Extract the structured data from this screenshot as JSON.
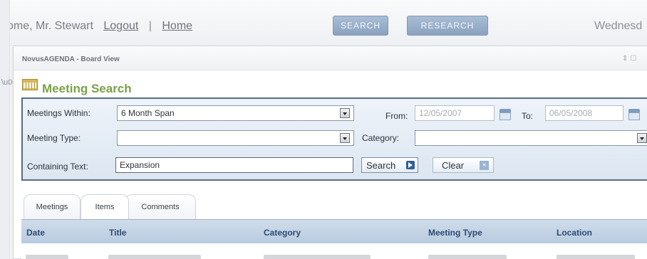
{
  "topbar": {
    "welcome_text": "come, Mr. Stewart",
    "logout_label": "Logout",
    "separator": "|",
    "home_label": "Home",
    "search_button": "SEARCH",
    "research_button": "RESEARCH",
    "date_text": "Wednesd"
  },
  "board": {
    "title": "NovusAGENDA - Board View",
    "window_controls": "⇕☐",
    "section_title": "Meeting Search"
  },
  "search_form": {
    "meetings_within_label": "Meetings Within:",
    "meetings_within_value": "6 Month Span",
    "from_label": "From:",
    "from_value": "12/05/2007",
    "to_label": "To:",
    "to_value": "06/05/2008",
    "meeting_type_label": "Meeting Type:",
    "meeting_type_value": "",
    "category_label": "Category:",
    "category_value": "",
    "containing_text_label": "Containing Text:",
    "containing_text_value": "Expansion",
    "search_button": "Search",
    "clear_button": "Clear",
    "clear_icon": "×"
  },
  "tabs": [
    {
      "label": "Meetings"
    },
    {
      "label": "Items",
      "active": true
    },
    {
      "label": "Comments"
    }
  ],
  "table": {
    "columns": [
      "Date",
      "Title",
      "Category",
      "Meeting Type",
      "Location"
    ]
  },
  "colors": {
    "accent_green": "#7aa048",
    "header_blue": "#2d4a72",
    "topbar_button": "#8aa3c0",
    "panel_border": "#5a6c82"
  },
  "icons": {
    "section_icon": "calendar-grid-icon",
    "date_picker": "calendar-icon",
    "search_go": "arrow-right-icon",
    "clear_x": "close-icon"
  }
}
